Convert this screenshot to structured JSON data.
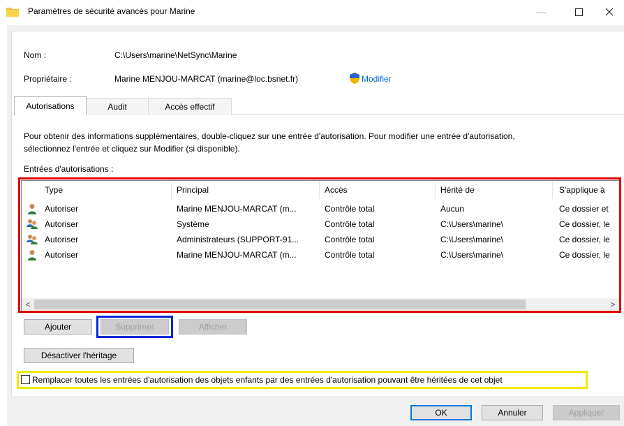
{
  "window": {
    "title": "Paramètres de sécurité avancés pour Marine",
    "minimize_glyph": "—",
    "maximize_glyph": "☐",
    "close_glyph": "✕"
  },
  "info": {
    "name_label": "Nom :",
    "name_value": "C:\\Users\\marine\\NetSync\\Marine",
    "owner_label": "Propriétaire :",
    "owner_value": "Marine MENJOU-MARCAT (marine@loc.bsnet.fr)",
    "modify_link": "Modifier"
  },
  "tabs": [
    {
      "label": "Autorisations",
      "active": true
    },
    {
      "label": "Audit",
      "active": false
    },
    {
      "label": "Accès effectif",
      "active": false
    }
  ],
  "description": {
    "line1": "Pour obtenir des informations supplémentaires, double-cliquez sur une entrée d'autorisation. Pour modifier une entrée d'autorisation,",
    "line2": "sélectionnez l'entrée et cliquez sur Modifier (si disponible)."
  },
  "entries_label": "Entrées d'autorisations :",
  "table": {
    "columns": [
      "Type",
      "Principal",
      "Accès",
      "Hérité de",
      "S'applique à"
    ],
    "rows": [
      {
        "icon": "single-user-icon",
        "type": "Autoriser",
        "principal": "Marine MENJOU-MARCAT (m...",
        "access": "Contrôle total",
        "inherited": "Aucun",
        "applies": "Ce dossier et"
      },
      {
        "icon": "group-users-icon",
        "type": "Autoriser",
        "principal": "Système",
        "access": "Contrôle total",
        "inherited": "C:\\Users\\marine\\",
        "applies": "Ce dossier, le"
      },
      {
        "icon": "group-users-icon",
        "type": "Autoriser",
        "principal": "Administrateurs (SUPPORT-91...",
        "access": "Contrôle total",
        "inherited": "C:\\Users\\marine\\",
        "applies": "Ce dossier, le"
      },
      {
        "icon": "single-user-icon",
        "type": "Autoriser",
        "principal": "Marine MENJOU-MARCAT (m...",
        "access": "Contrôle total",
        "inherited": "C:\\Users\\marine\\",
        "applies": "Ce dossier, le"
      }
    ]
  },
  "scroll": {
    "left": "<",
    "right": ">"
  },
  "buttons": {
    "add": "Ajouter",
    "remove": "Supprimer",
    "view": "Afficher",
    "disable_inheritance": "Désactiver l'héritage",
    "ok": "OK",
    "cancel": "Annuler",
    "apply": "Appliquer"
  },
  "replace_checkbox": {
    "label": "Remplacer toutes les entrées d'autorisation des objets enfants par des entrées d'autorisation pouvant être héritées de cet objet",
    "checked": false
  },
  "colors": {
    "link": "#0066cc",
    "highlight_red": "#e00000",
    "highlight_blue": "#0028d7",
    "highlight_yellow": "#f0e800",
    "folder": "#f5c242"
  }
}
